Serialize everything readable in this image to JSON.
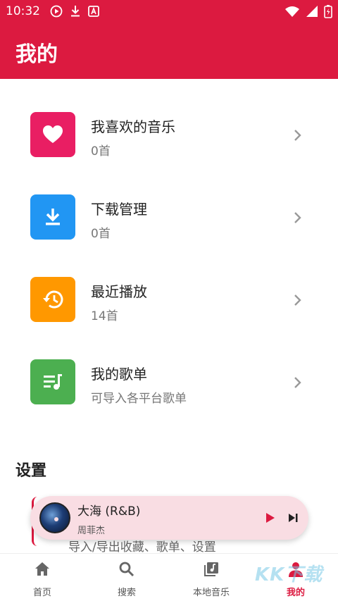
{
  "status_bar": {
    "time": "10:32"
  },
  "header": {
    "title": "我的",
    "bg_color": "#dc1a40"
  },
  "list": [
    {
      "title": "我喜欢的音乐",
      "subtitle": "0首",
      "icon": "heart-icon",
      "color": "#e91e63"
    },
    {
      "title": "下载管理",
      "subtitle": "0首",
      "icon": "download-icon",
      "color": "#2196f3"
    },
    {
      "title": "最近播放",
      "subtitle": "14首",
      "icon": "history-icon",
      "color": "#ff9800"
    },
    {
      "title": "我的歌单",
      "subtitle": "可导入各平台歌单",
      "icon": "playlist-icon",
      "color": "#4caf50"
    }
  ],
  "settings": {
    "title": "设置",
    "subtitle": "导入/导出收藏、歌单、设置"
  },
  "mini_player": {
    "song_title": "大海 (R&B)",
    "artist": "周菲杰"
  },
  "bottom_nav": [
    {
      "label": "首页",
      "icon": "home-icon"
    },
    {
      "label": "搜索",
      "icon": "search-icon"
    },
    {
      "label": "本地音乐",
      "icon": "music-library-icon"
    },
    {
      "label": "我的",
      "icon": "profile-icon",
      "active": true
    }
  ],
  "watermark": "KK下载"
}
